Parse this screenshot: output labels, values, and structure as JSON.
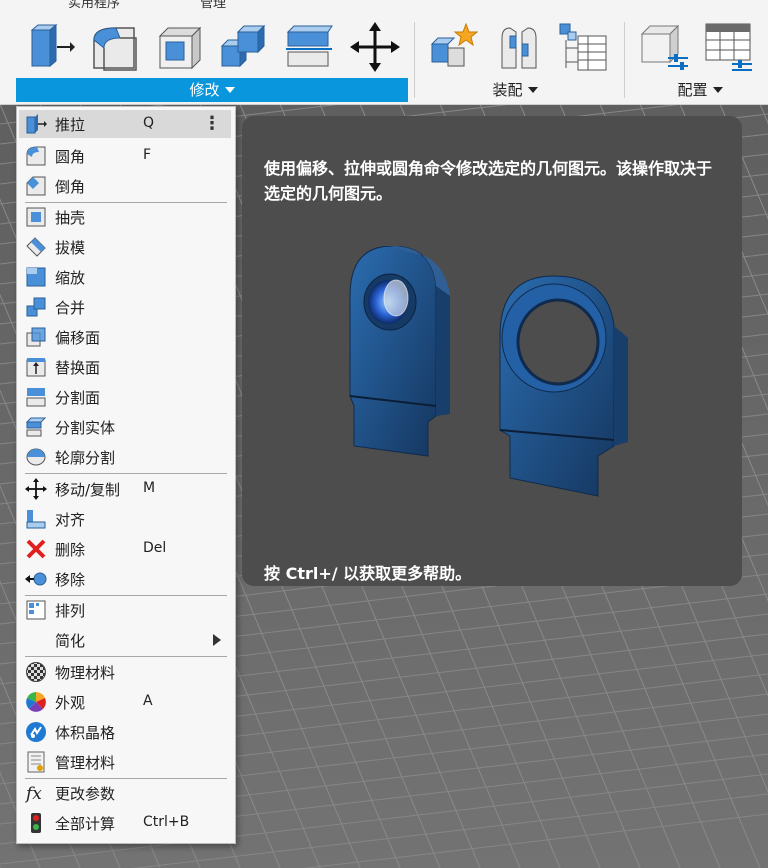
{
  "top_tabs": [
    "实用程序",
    "管理"
  ],
  "toolbar": {
    "groups": [
      {
        "label": "修改",
        "active": true,
        "icons": [
          "press-pull-icon",
          "fillet-icon",
          "shell-icon",
          "combine-icon",
          "split-face-icon",
          "move-icon"
        ]
      },
      {
        "label": "装配",
        "active": false,
        "icons": [
          "new-component-icon",
          "joint-icon",
          "component-table-icon"
        ]
      },
      {
        "label": "配置",
        "active": false,
        "icons": [
          "configure-model-icon",
          "configuration-table-icon"
        ]
      }
    ]
  },
  "menu": {
    "items": [
      {
        "label": "推拉",
        "shortcut": "Q",
        "icon": "press-pull-icon",
        "highlighted": true,
        "more": "⋮"
      },
      {
        "label": "圆角",
        "shortcut": "F",
        "icon": "fillet-icon"
      },
      {
        "label": "倒角",
        "shortcut": "",
        "icon": "chamfer-icon"
      },
      {
        "label": "抽壳",
        "shortcut": "",
        "icon": "shell-icon"
      },
      {
        "label": "拔模",
        "shortcut": "",
        "icon": "draft-icon"
      },
      {
        "label": "缩放",
        "shortcut": "",
        "icon": "scale-icon"
      },
      {
        "label": "合并",
        "shortcut": "",
        "icon": "combine-icon"
      },
      {
        "label": "偏移面",
        "shortcut": "",
        "icon": "offset-face-icon"
      },
      {
        "label": "替换面",
        "shortcut": "",
        "icon": "replace-face-icon"
      },
      {
        "label": "分割面",
        "shortcut": "",
        "icon": "split-face-icon"
      },
      {
        "label": "分割实体",
        "shortcut": "",
        "icon": "split-body-icon"
      },
      {
        "label": "轮廓分割",
        "shortcut": "",
        "icon": "silhouette-split-icon"
      },
      {
        "label": "移动/复制",
        "shortcut": "M",
        "icon": "move-icon"
      },
      {
        "label": "对齐",
        "shortcut": "",
        "icon": "align-icon"
      },
      {
        "label": "删除",
        "shortcut": "Del",
        "icon": "delete-icon"
      },
      {
        "label": "移除",
        "shortcut": "",
        "icon": "remove-icon"
      },
      {
        "label": "排列",
        "shortcut": "",
        "icon": "arrange-icon"
      },
      {
        "label": "简化",
        "shortcut": "",
        "icon": "",
        "submenu": true
      },
      {
        "label": "物理材料",
        "shortcut": "",
        "icon": "physical-material-icon"
      },
      {
        "label": "外观",
        "shortcut": "A",
        "icon": "appearance-icon"
      },
      {
        "label": "体积晶格",
        "shortcut": "",
        "icon": "volumetric-lattice-icon"
      },
      {
        "label": "管理材料",
        "shortcut": "",
        "icon": "manage-materials-icon"
      },
      {
        "label": "更改参数",
        "shortcut": "",
        "icon": "change-parameters-icon"
      },
      {
        "label": "全部计算",
        "shortcut": "Ctrl+B",
        "icon": "compute-all-icon"
      }
    ]
  },
  "tooltip": {
    "description": "使用偏移、拉伸或圆角命令修改选定的几何图元。该操作取决于选定的几何图元。",
    "help": "按 Ctrl+/ 以获取更多帮助。"
  },
  "colors": {
    "accent": "#0a96dc",
    "toolbar_bg": "#f4f4f4",
    "menu_bg": "#f7f7f7",
    "tooltip_bg": "#4d4d4d",
    "part_blue": "#1f4f86",
    "delete_red": "#e0201e"
  }
}
